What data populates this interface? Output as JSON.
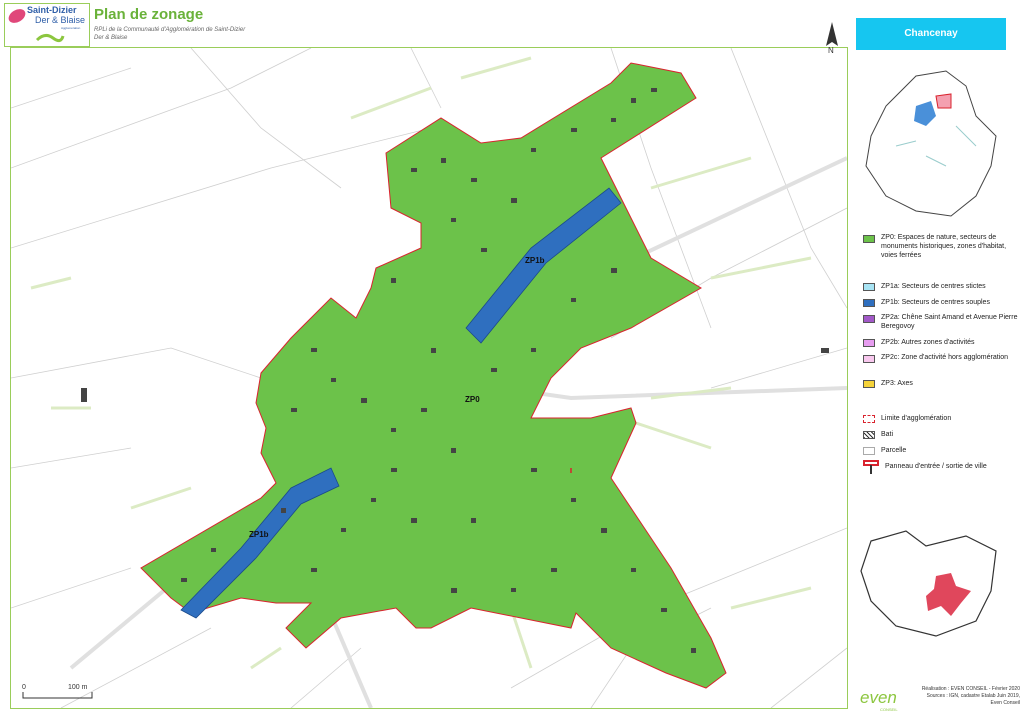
{
  "header": {
    "logo_line1": "Saint-Dizier",
    "logo_line2": "Der & Blaise",
    "logo_line3": "Agglomération",
    "title": "Plan de zonage",
    "subtitle": "RPLi de la Communauté d'Agglomération de Saint-Dizier Der & Blaise"
  },
  "map": {
    "zone_labels": [
      "ZP1b",
      "ZP0",
      "ZP1b"
    ],
    "north_label": "N",
    "scale": {
      "start": "0",
      "end": "100 m"
    }
  },
  "side": {
    "commune": "Chancenay",
    "legend": [
      {
        "label": "ZP0: Espaces de nature, secteurs de monuments historiques, zones d'habitat, voies ferrées",
        "color": "#6cc24a"
      },
      {
        "label": "ZP1a: Secteurs de centres stictes",
        "color": "#a8e4f4"
      },
      {
        "label": "ZP1b: Secteurs de centres souples",
        "color": "#2f6fbf"
      },
      {
        "label": "ZP2a: Chêne Saint Amand et Avenue Pierre Beregovoy",
        "color": "#a259c8"
      },
      {
        "label": "ZP2b: Autres zones d'activités",
        "color": "#e79df0"
      },
      {
        "label": "ZP2c: Zone d'activité hors agglomération",
        "color": "#f8c8ee"
      },
      {
        "label": "ZP3: Axes",
        "color": "#f5d33a"
      }
    ],
    "legend2": [
      {
        "label": "Limite d'agglomération",
        "icon": "dashed-red-box-icon"
      },
      {
        "label": "Bati",
        "icon": "hatched-box-icon"
      },
      {
        "label": "Parcelle",
        "icon": "empty-box-icon"
      },
      {
        "label": "Panneau d'entrée / sortie de ville",
        "icon": "sign-icon"
      }
    ]
  },
  "footer": {
    "logo": "even",
    "logo_sub": "CONSEIL",
    "credits_1": "Réalisation : EVEN CONSEIL - Février 2020",
    "credits_2": "Sources : IGN, cadastre Etalab Juin 2019,",
    "credits_3": "Even Conseil"
  },
  "colors": {
    "zp0": "#6cc24a",
    "zp1b": "#2f6fbf",
    "accent": "#16c6f0",
    "limit": "#d9232e"
  }
}
